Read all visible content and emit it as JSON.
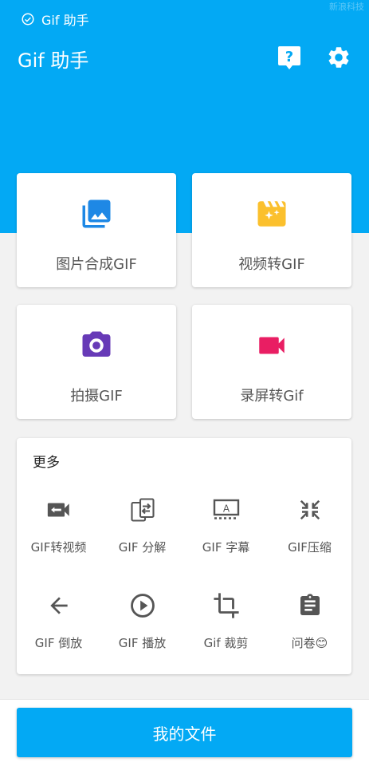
{
  "status": {
    "label": "Gif 助手",
    "watermark": "新浪科技"
  },
  "app": {
    "title": "Gif 助手"
  },
  "actions": {
    "help_icon": "help-icon",
    "settings_icon": "gear-icon"
  },
  "colors": {
    "primary": "#03a9f4",
    "blue": "#1e88e5",
    "yellow": "#fbc02d",
    "purple": "#673ab7",
    "pink": "#e91e63",
    "gray": "#555555"
  },
  "features": [
    {
      "label": "图片合成GIF",
      "icon": "photo-library-icon"
    },
    {
      "label": "视频转GIF",
      "icon": "movie-clapper-icon"
    },
    {
      "label": "拍摄GIF",
      "icon": "camera-icon"
    },
    {
      "label": "录屏转Gif",
      "icon": "videocam-icon"
    }
  ],
  "more": {
    "title": "更多",
    "tools": [
      {
        "label": "GIF转视频",
        "icon": "video-convert-icon"
      },
      {
        "label": "GIF 分解",
        "icon": "split-icon"
      },
      {
        "label": "GIF 字幕",
        "icon": "subtitle-icon"
      },
      {
        "label": "GIF压缩",
        "icon": "compress-icon"
      },
      {
        "label": "GIF 倒放",
        "icon": "arrow-left-icon"
      },
      {
        "label": "GIF 播放",
        "icon": "play-circle-icon"
      },
      {
        "label": "Gif 裁剪",
        "icon": "crop-icon"
      },
      {
        "label": "问卷😊",
        "icon": "clipboard-icon"
      }
    ]
  },
  "bottom": {
    "files_label": "我的文件"
  }
}
